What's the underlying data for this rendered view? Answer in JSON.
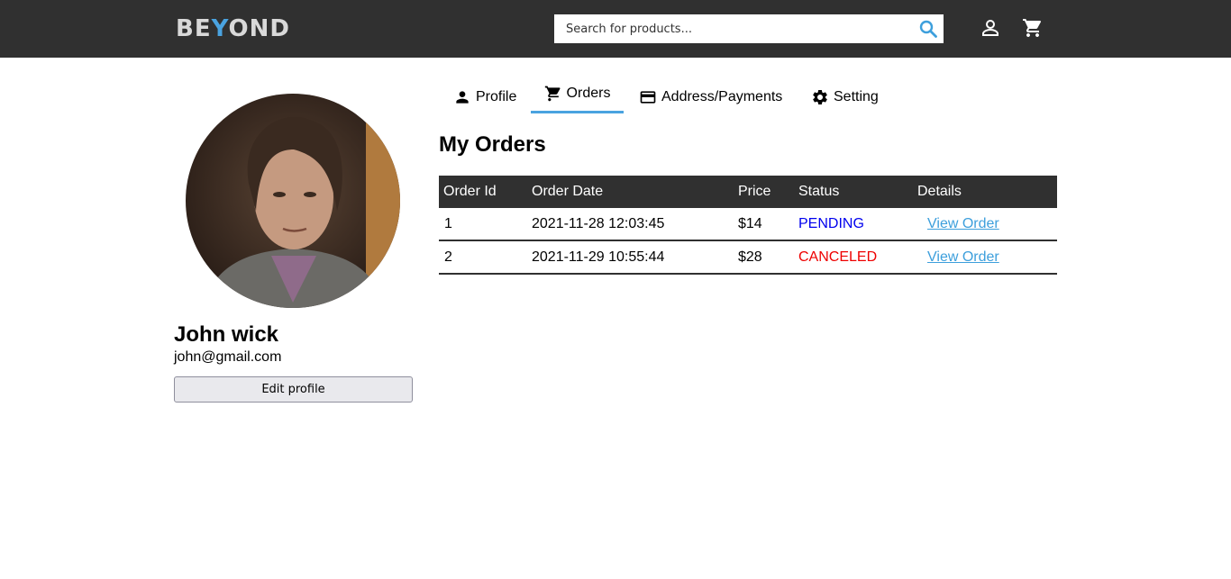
{
  "header": {
    "logo_main": "BE",
    "logo_accent": "Y",
    "logo_rest": "OND",
    "search": {
      "placeholder": "Search for products..."
    },
    "colors": {
      "bar": "#303030",
      "accent": "#4aa3e0"
    },
    "icons": [
      "search-icon",
      "account-icon",
      "cart-icon"
    ]
  },
  "profile": {
    "name": "John wick",
    "email": "john@gmail.com",
    "edit_label": "Edit profile"
  },
  "tabs": [
    {
      "label": "Profile",
      "icon": "person-icon",
      "active": false
    },
    {
      "label": "Orders",
      "icon": "cart-icon",
      "active": true
    },
    {
      "label": "Address/Payments",
      "icon": "credit-card-icon",
      "active": false
    },
    {
      "label": "Setting",
      "icon": "gear-icon",
      "active": false
    }
  ],
  "orders": {
    "title": "My Orders",
    "columns": [
      "Order Id",
      "Order Date",
      "Price",
      "Status",
      "Details"
    ],
    "rows": [
      {
        "id": "1",
        "date": "2021-11-28 12:03:45",
        "price": "$14",
        "status": "PENDING",
        "status_color": "#0000ee",
        "details": "View Order"
      },
      {
        "id": "2",
        "date": "2021-11-29 10:55:44",
        "price": "$28",
        "status": "CANCELED",
        "status_color": "#ee0000",
        "details": "View Order"
      }
    ]
  }
}
